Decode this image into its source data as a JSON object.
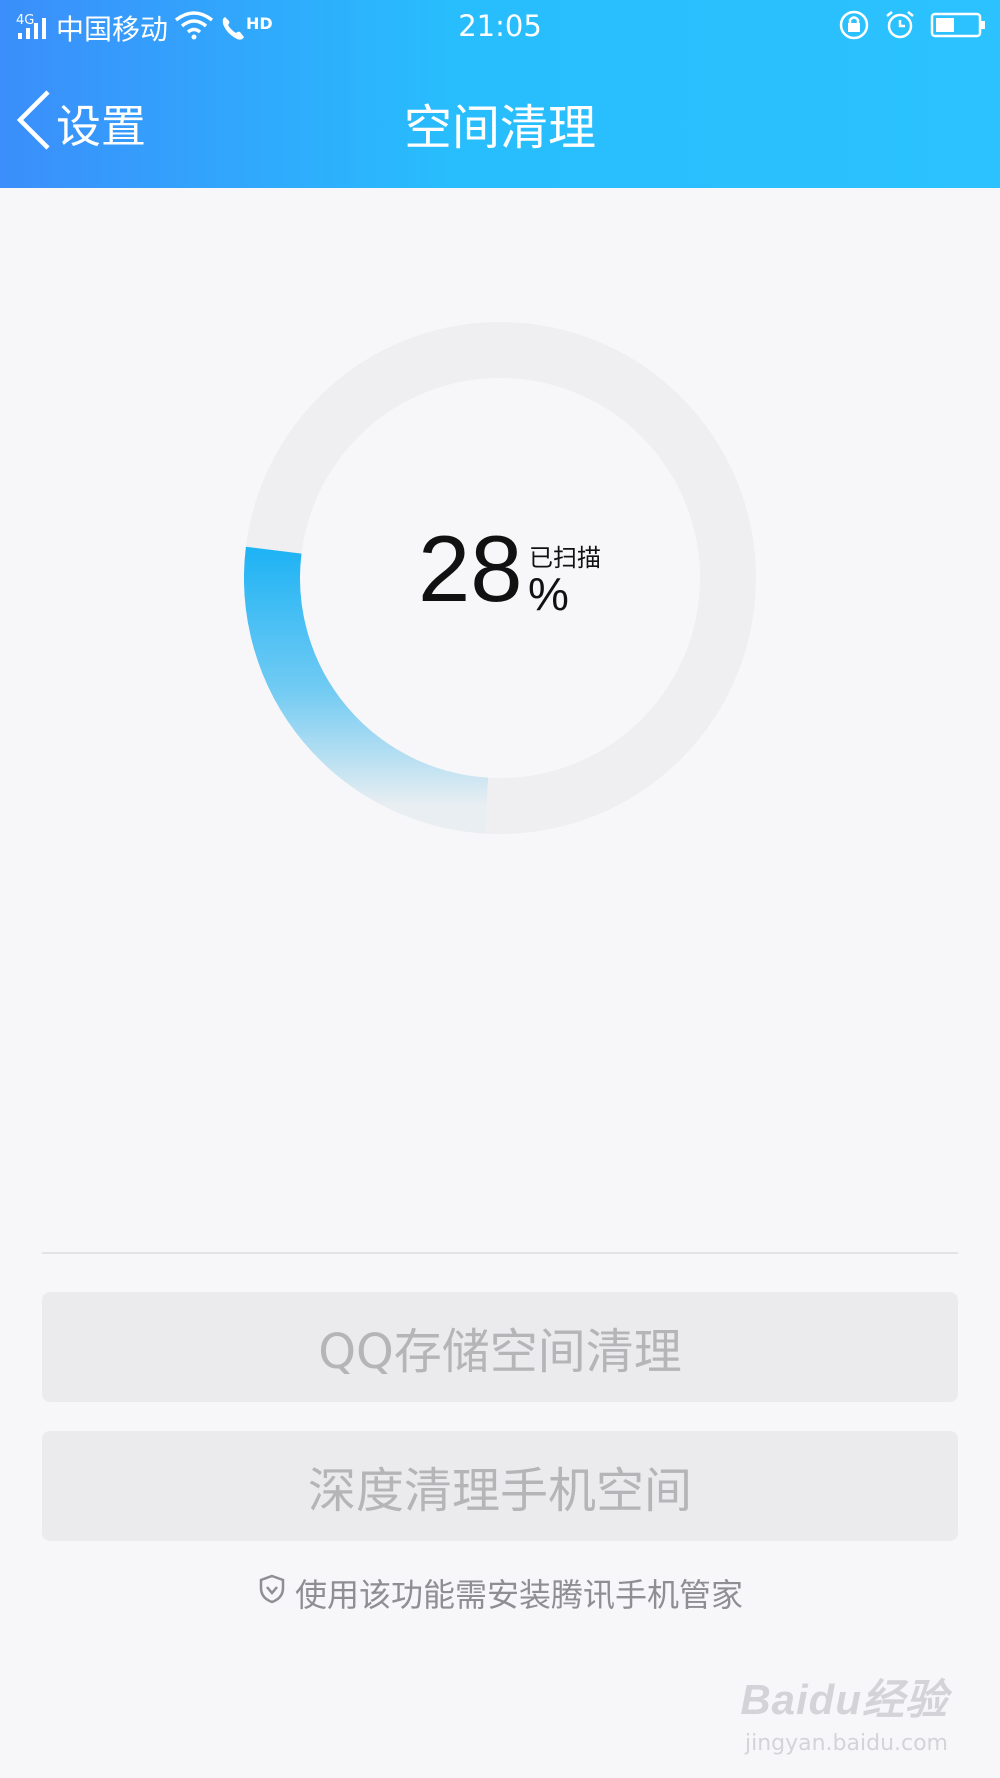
{
  "status_bar": {
    "network": "4G",
    "carrier": "中国移动",
    "call_badge": "HD",
    "time": "21:05"
  },
  "nav": {
    "back_label": "设置",
    "title": "空间清理"
  },
  "scan": {
    "progress_percent": 28,
    "number": "28",
    "label": "已扫描",
    "percent_sign": "%"
  },
  "buttons": {
    "qq_storage": "QQ存储空间清理",
    "deep_clean": "深度清理手机空间"
  },
  "hint": {
    "text": "使用该功能需安装腾讯手机管家",
    "icon": "shield-icon"
  },
  "watermark": {
    "brand": "Baidu经验",
    "url": "jingyan.baidu.com"
  },
  "colors": {
    "header_start": "#3b8efb",
    "header_end": "#2bc2ff",
    "progress": "#1fb3f5",
    "ring_track": "#efeff2",
    "button_bg": "#ebebee",
    "button_text": "#b5b5b8"
  }
}
